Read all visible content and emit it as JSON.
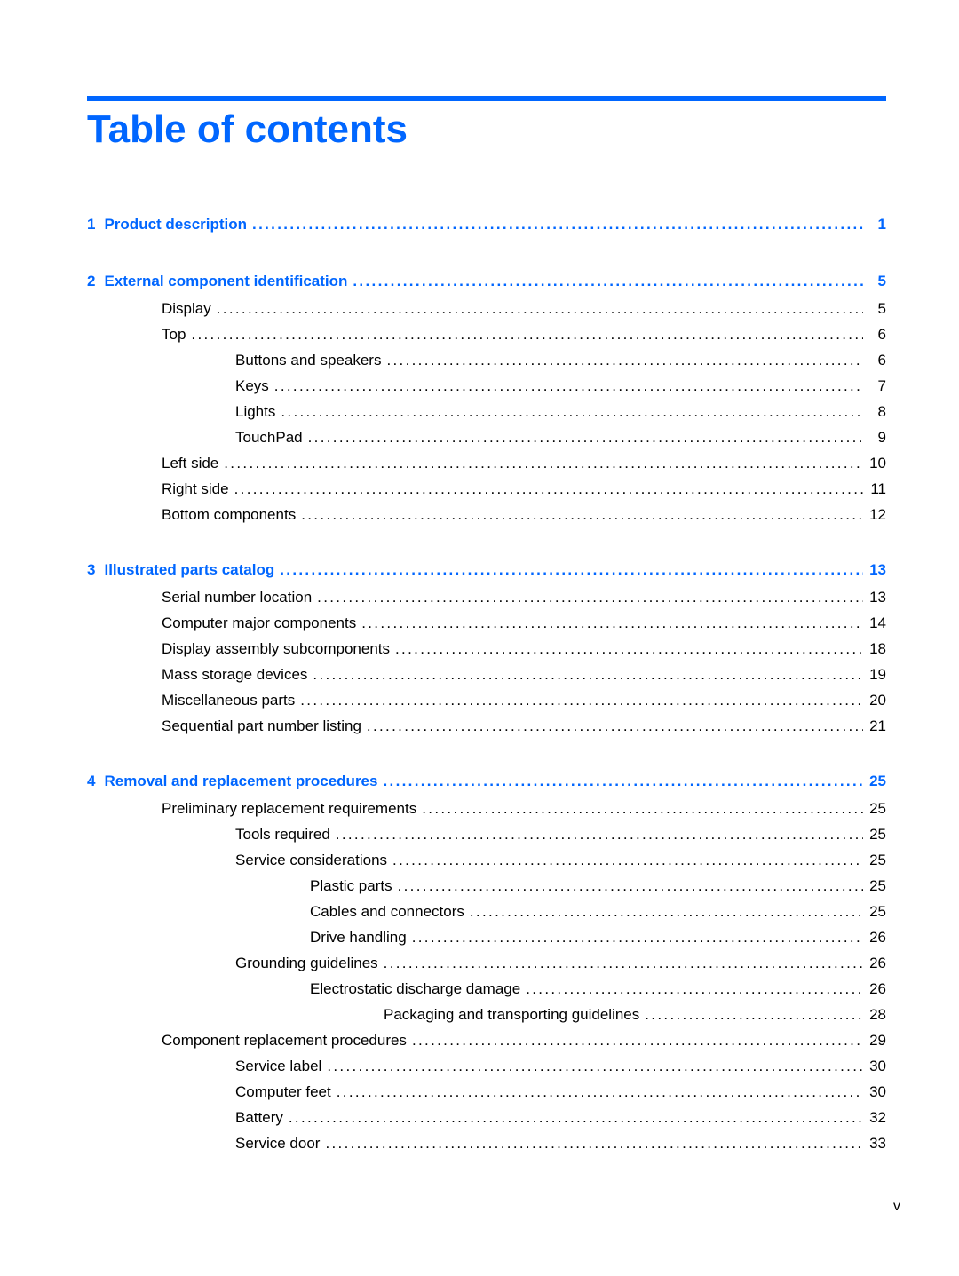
{
  "page": {
    "title": "Table of contents",
    "folio": "v",
    "accent_color": "#0066ff"
  },
  "toc": [
    {
      "type": "chapter",
      "num": "1",
      "label": "Product description",
      "page": "1"
    },
    {
      "type": "chapter",
      "num": "2",
      "label": "External component identification",
      "page": "5"
    },
    {
      "type": "l1",
      "label": "Display",
      "page": "5"
    },
    {
      "type": "l1",
      "label": "Top",
      "page": "6"
    },
    {
      "type": "l2",
      "label": "Buttons and speakers",
      "page": "6"
    },
    {
      "type": "l2",
      "label": "Keys",
      "page": "7"
    },
    {
      "type": "l2",
      "label": "Lights",
      "page": "8"
    },
    {
      "type": "l2",
      "label": "TouchPad",
      "page": "9"
    },
    {
      "type": "l1",
      "label": "Left side",
      "page": "10"
    },
    {
      "type": "l1",
      "label": "Right side",
      "page": "11"
    },
    {
      "type": "l1",
      "label": "Bottom components",
      "page": "12"
    },
    {
      "type": "chapter",
      "num": "3",
      "label": "Illustrated parts catalog",
      "page": "13"
    },
    {
      "type": "l1",
      "label": "Serial number location",
      "page": "13"
    },
    {
      "type": "l1",
      "label": "Computer major components",
      "page": "14"
    },
    {
      "type": "l1",
      "label": "Display assembly subcomponents",
      "page": "18"
    },
    {
      "type": "l1",
      "label": "Mass storage devices",
      "page": "19"
    },
    {
      "type": "l1",
      "label": "Miscellaneous parts",
      "page": "20"
    },
    {
      "type": "l1",
      "label": "Sequential part number listing",
      "page": "21"
    },
    {
      "type": "chapter",
      "num": "4",
      "label": "Removal and replacement procedures",
      "page": "25"
    },
    {
      "type": "l1",
      "label": "Preliminary replacement requirements",
      "page": "25"
    },
    {
      "type": "l2",
      "label": "Tools required",
      "page": "25"
    },
    {
      "type": "l2",
      "label": "Service considerations",
      "page": "25"
    },
    {
      "type": "l3",
      "label": "Plastic parts",
      "page": "25"
    },
    {
      "type": "l3",
      "label": "Cables and connectors",
      "page": "25"
    },
    {
      "type": "l3",
      "label": "Drive handling",
      "page": "26"
    },
    {
      "type": "l2",
      "label": "Grounding guidelines",
      "page": "26"
    },
    {
      "type": "l3",
      "label": "Electrostatic discharge damage",
      "page": "26"
    },
    {
      "type": "l4",
      "label": "Packaging and transporting guidelines",
      "page": "28"
    },
    {
      "type": "l1",
      "label": "Component replacement procedures",
      "page": "29"
    },
    {
      "type": "l2",
      "label": "Service label",
      "page": "30"
    },
    {
      "type": "l2",
      "label": "Computer feet",
      "page": "30"
    },
    {
      "type": "l2",
      "label": "Battery",
      "page": "32"
    },
    {
      "type": "l2",
      "label": "Service door",
      "page": "33"
    }
  ]
}
